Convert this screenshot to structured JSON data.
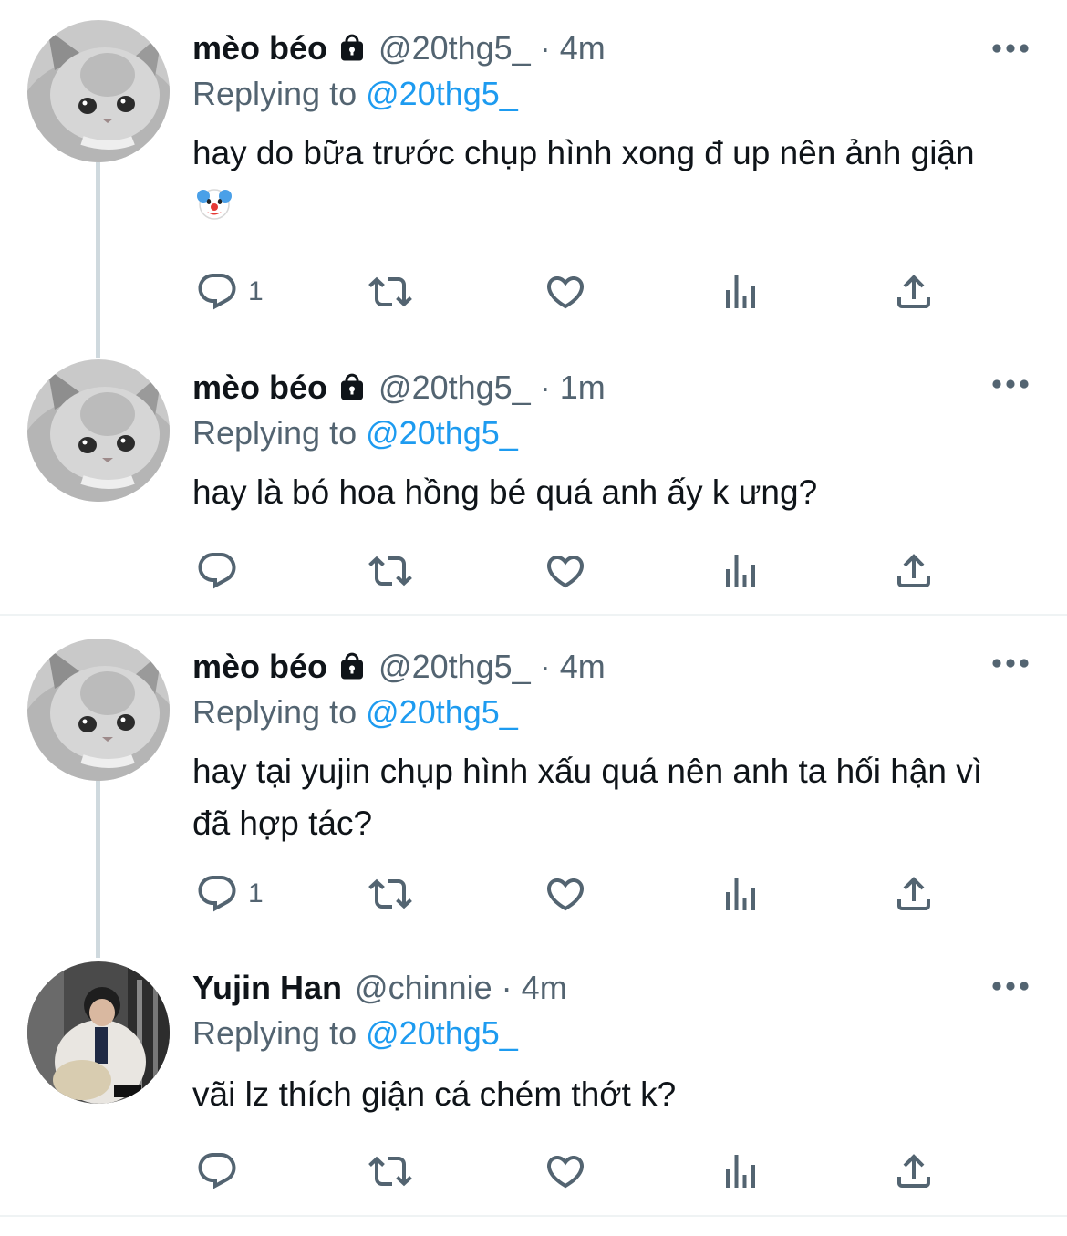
{
  "tweets": [
    {
      "name": "mèo béo",
      "handle": "@20thg5_",
      "dot": "·",
      "time": "4m",
      "replying_prefix": "Replying to",
      "replying_to": "@20thg5_",
      "text": "hay do bữa trước chụp hình xong đ up nên ảnh giận",
      "emoji": "clown-face",
      "reply_count": "1",
      "locked": true
    },
    {
      "name": "mèo béo",
      "handle": "@20thg5_",
      "dot": "·",
      "time": "1m",
      "replying_prefix": "Replying to",
      "replying_to": "@20thg5_",
      "text": "hay là bó hoa hồng bé quá anh ấy k ưng?",
      "reply_count": "",
      "locked": true
    },
    {
      "name": "mèo béo",
      "handle": "@20thg5_",
      "dot": "·",
      "time": "4m",
      "replying_prefix": "Replying to",
      "replying_to": "@20thg5_",
      "text": "hay tại yujin chụp hình xấu quá nên anh ta hối hận vì đã hợp tác?",
      "reply_count": "1",
      "locked": true
    },
    {
      "name": "Yujin Han",
      "handle": "@chinnie",
      "dot": "·",
      "time": "4m",
      "replying_prefix": "Replying to",
      "replying_to": "@20thg5_",
      "text": "vãi lz thích giận cá chém thớt k?",
      "reply_count": "",
      "locked": false
    }
  ],
  "icons": [
    "lock-icon",
    "more-icon",
    "reply-icon",
    "retweet-icon",
    "like-icon",
    "views-icon",
    "share-icon"
  ],
  "colors": {
    "text": "#0f1419",
    "secondary": "#536471",
    "link": "#1d9bf0",
    "line": "#cfd9de",
    "divider": "#eff3f4"
  }
}
